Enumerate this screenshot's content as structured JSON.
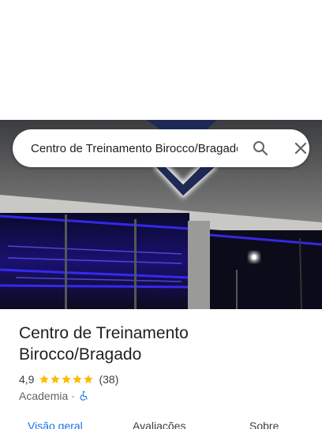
{
  "search": {
    "query": "Centro de Treinamento Birocco/Bragado"
  },
  "place": {
    "name": "Centro de Treinamento Birocco/Bragado",
    "rating": "4,9",
    "stars": 5,
    "review_count": "(38)",
    "category": "Academia",
    "separator": "·"
  },
  "tabs": [
    {
      "label": "Visão geral",
      "active": true
    },
    {
      "label": "Avaliações",
      "active": false
    },
    {
      "label": "Sobre",
      "active": false
    }
  ],
  "colors": {
    "accent": "#1a73e8",
    "star": "#fbbc04",
    "neon": "#3a2bff"
  },
  "icons": {
    "search": "search-icon",
    "close": "close-icon",
    "wheelchair": "wheelchair-accessible-icon"
  }
}
